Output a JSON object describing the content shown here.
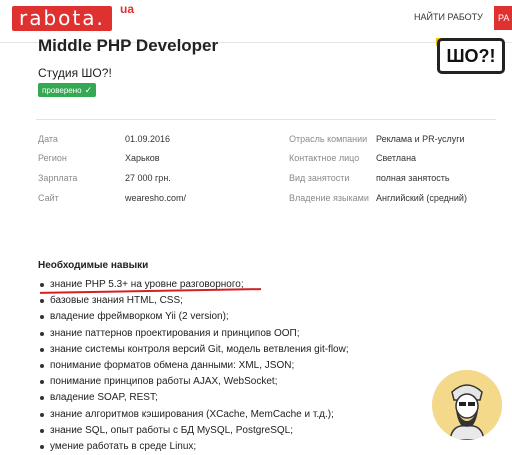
{
  "header": {
    "logo_text": "rabota.",
    "logo_suffix": "ua",
    "find_job": "НАЙТИ РАБОТУ",
    "cut_button": "РА"
  },
  "vacancy": {
    "title": "Middle PHP Developer",
    "company": "Студия ШО?!",
    "verified": "проверено",
    "company_logo_text": "ШО?!"
  },
  "details_left": [
    {
      "label": "Дата",
      "value": "01.09.2016"
    },
    {
      "label": "Регион",
      "value": "Харьков"
    },
    {
      "label": "Зарплата",
      "value": "27 000 грн."
    },
    {
      "label": "Сайт",
      "value": "wearesho.com/"
    }
  ],
  "details_right": [
    {
      "label": "Отрасль компании",
      "value": "Реклама и PR-услуги"
    },
    {
      "label": "Контактное лицо",
      "value": "Светлана"
    },
    {
      "label": "Вид занятости",
      "value": "полная занятость"
    },
    {
      "label": "Владение языками",
      "value": "Английский (средний)"
    }
  ],
  "skills": {
    "heading": "Необходимые навыки",
    "items": [
      "знание PHP 5.3+ на уровне разговорного;",
      "базовые знания HTML, CSS;",
      "владение фреймворком Yii (2 version);",
      "знание паттернов проектирования и принципов ООП;",
      "знание системы контроля версий Git, модель ветвления git-flow;",
      "понимание форматов обмена данными: XML, JSON;",
      "понимание принципов работы AJAX, WebSocket;",
      "владение SOAP, REST;",
      "знание алгоритмов кэширования (XCache, MemCache и т.д.);",
      "знание SQL, опыт работы с БД MySQL, PostgreSQL;",
      "умение работать в среде Linux;"
    ]
  },
  "colors": {
    "brand_red": "#e03131",
    "verified_green": "#35a853",
    "avatar_bg": "#f4d98a"
  }
}
